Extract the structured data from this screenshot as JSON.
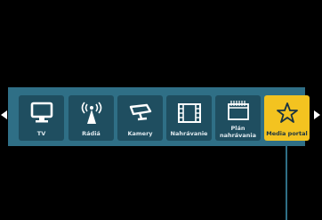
{
  "colors": {
    "background": "#000000",
    "bar": "#2f6f86",
    "tile": "#1f4e60",
    "tile_selected": "#f3c320",
    "label": "#dfe9ee"
  },
  "menu": {
    "items": [
      {
        "label": "TV",
        "icon": "tv-icon"
      },
      {
        "label": "Rádiá",
        "icon": "radio-antenna-icon"
      },
      {
        "label": "Kamery",
        "icon": "camera-icon"
      },
      {
        "label": "Nahrávanie",
        "icon": "film-icon"
      },
      {
        "label_line1": "Plán",
        "label_line2": "nahrávania",
        "icon": "calendar-icon"
      },
      {
        "label": "Media portal",
        "icon": "star-icon",
        "selected": true
      }
    ]
  }
}
